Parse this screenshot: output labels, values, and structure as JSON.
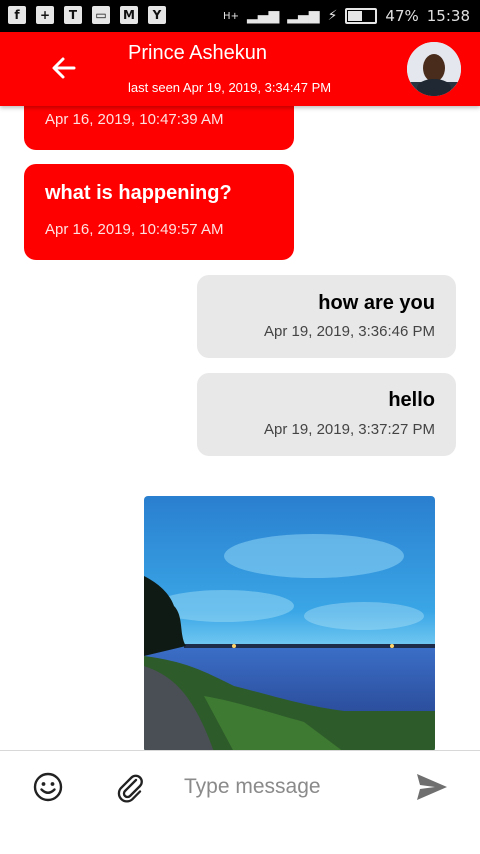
{
  "status_bar": {
    "battery": "47%",
    "time": "15:38",
    "network": "H+"
  },
  "header": {
    "contact_name": "Prince Ashekun",
    "last_seen": "last seen Apr 19, 2019, 3:34:47 PM"
  },
  "messages": [
    {
      "direction": "incoming",
      "text": "",
      "time": "Apr 16, 2019, 10:47:39 AM"
    },
    {
      "direction": "incoming",
      "text": "what is happening?",
      "time": "Apr 16, 2019, 10:49:57 AM"
    },
    {
      "direction": "outgoing",
      "text": "how are you",
      "time": "Apr 19, 2019, 3:36:46 PM"
    },
    {
      "direction": "outgoing",
      "text": "hello",
      "time": "Apr 19, 2019, 3:37:27 PM"
    }
  ],
  "composer": {
    "placeholder": "Type message"
  },
  "colors": {
    "accent": "#ff0000",
    "outgoing_bubble": "#e8e8e8"
  },
  "icons": [
    "back-arrow-icon",
    "smiley-icon",
    "paperclip-icon",
    "send-icon"
  ]
}
